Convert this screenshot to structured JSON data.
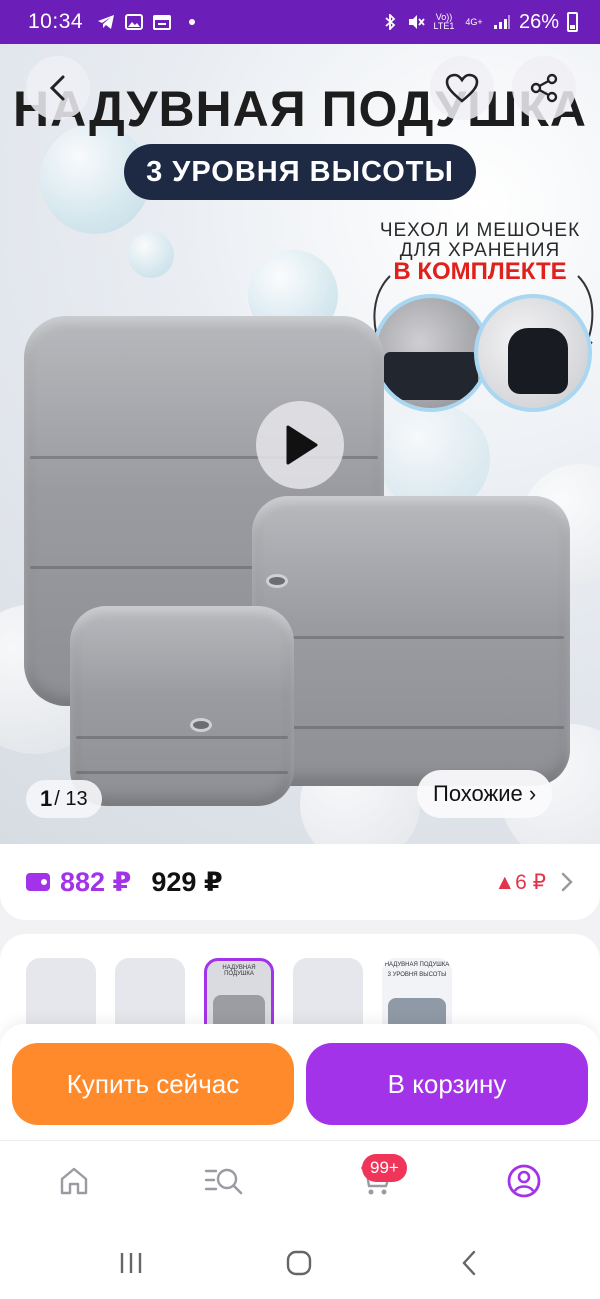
{
  "status_bar": {
    "time": "10:34",
    "volte": "Vo)) LTE1",
    "network": "4G+",
    "battery": "26%"
  },
  "hero": {
    "title": "НАДУВНАЯ ПОДУШКА",
    "badge": "3 УРОВНЯ ВЫСОТЫ",
    "kit_line1": "ЧЕХОЛ И МЕШОЧЕК",
    "kit_line2": "ДЛЯ ХРАНЕНИЯ",
    "kit_line3": "В КОМПЛЕКТЕ",
    "counter_current": "1",
    "counter_total": "/ 13",
    "similar_label": "Похожие ›"
  },
  "price": {
    "current": "882 ₽",
    "old": "929 ₽",
    "delta": "▲6 ₽"
  },
  "thumbnails": {
    "thumb3_title": "НАДУВНАЯ ПОДУШКА",
    "thumb5_title": "НАДУВНАЯ ПОДУШКА",
    "thumb5_badge": "3 УРОВНЯ ВЫСОТЫ"
  },
  "actions": {
    "buy_now": "Купить сейчас",
    "add_to_cart": "В корзину"
  },
  "nav": {
    "cart_badge": "99+"
  },
  "colors": {
    "accent": "#a233e8",
    "orange": "#ff8a2b",
    "status_bar": "#6b1fb8",
    "badge": "#f0345a"
  }
}
